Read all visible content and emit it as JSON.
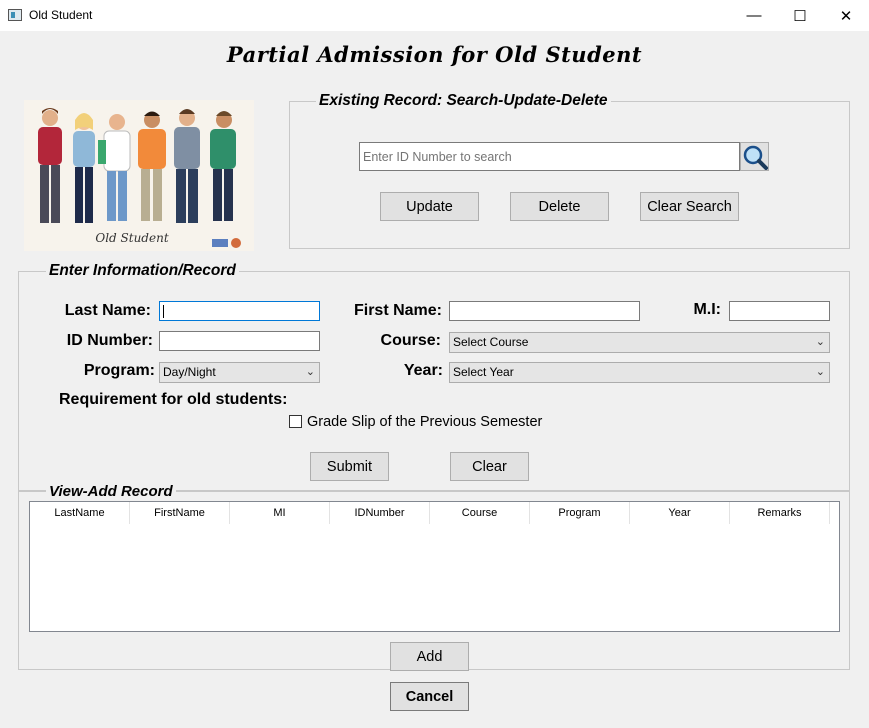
{
  "window": {
    "title": "Old Student",
    "minimize": "—",
    "maximize": "☐",
    "close": "✕"
  },
  "heading": "Partial Admission for Old Student",
  "picture": {
    "caption": "Old Student"
  },
  "search_group": {
    "title": "Existing Record: Search-Update-Delete",
    "placeholder": "Enter ID Number to search",
    "update_label": "Update",
    "delete_label": "Delete",
    "clear_search_label": "Clear Search"
  },
  "form": {
    "title": "Enter Information/Record",
    "last_name_label": "Last Name:",
    "first_name_label": "First Name:",
    "mi_label": "M.I:",
    "id_number_label": "ID Number:",
    "course_label": "Course:",
    "course_value": "Select Course",
    "program_label": "Program:",
    "program_value": "Day/Night",
    "year_label": "Year:",
    "year_value": "Select Year",
    "requirement_label": "Requirement for old students:",
    "grade_slip_label": "Grade Slip of the Previous Semester",
    "submit_label": "Submit",
    "clear_label": "Clear"
  },
  "records": {
    "title": "View-Add Record",
    "columns": [
      "LastName",
      "FirstName",
      "MI",
      "IDNumber",
      "Course",
      "Program",
      "Year",
      "Remarks"
    ],
    "add_label": "Add"
  },
  "cancel_label": "Cancel",
  "colors": {
    "focus_border": "#0078d7",
    "button_face": "#e1e1e1",
    "window_bg": "#f0f0f0"
  }
}
